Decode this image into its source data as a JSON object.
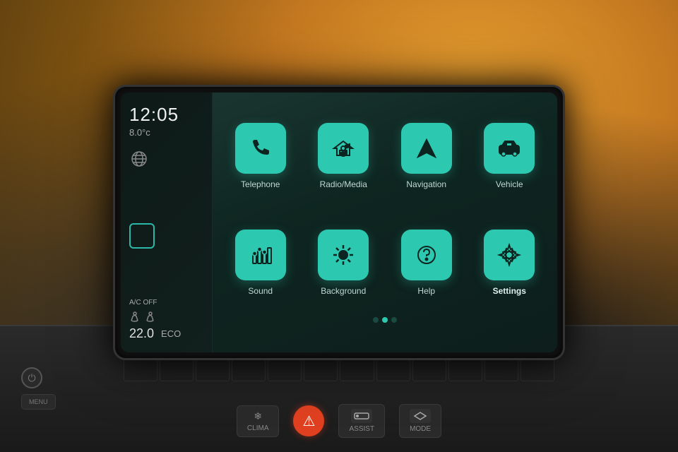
{
  "screen": {
    "time": "12:05",
    "temperature": "8.0°c",
    "ac_label": "A/C OFF",
    "temp_bottom": "22.0",
    "eco_label": "ECO",
    "apps": [
      {
        "id": "telephone",
        "label": "Telephone",
        "icon": "phone",
        "bold": false
      },
      {
        "id": "radio_media",
        "label": "Radio/Media",
        "icon": "music",
        "bold": false
      },
      {
        "id": "navigation",
        "label": "Navigation",
        "icon": "nav",
        "bold": false
      },
      {
        "id": "vehicle",
        "label": "Vehicle",
        "icon": "car",
        "bold": false
      },
      {
        "id": "sound",
        "label": "Sound",
        "icon": "equalizer",
        "bold": false
      },
      {
        "id": "background",
        "label": "Background",
        "icon": "bulb",
        "bold": false
      },
      {
        "id": "help",
        "label": "Help",
        "icon": "question",
        "bold": false
      },
      {
        "id": "settings",
        "label": "Settings",
        "icon": "gear",
        "bold": true
      }
    ],
    "dots": [
      {
        "active": false
      },
      {
        "active": true
      },
      {
        "active": false
      }
    ]
  },
  "dashboard": {
    "power_label": "⏻",
    "menu_label": "MENU",
    "clima_label": "CLIMA",
    "assist_label": "ASSIST",
    "mode_label": "MODE"
  }
}
